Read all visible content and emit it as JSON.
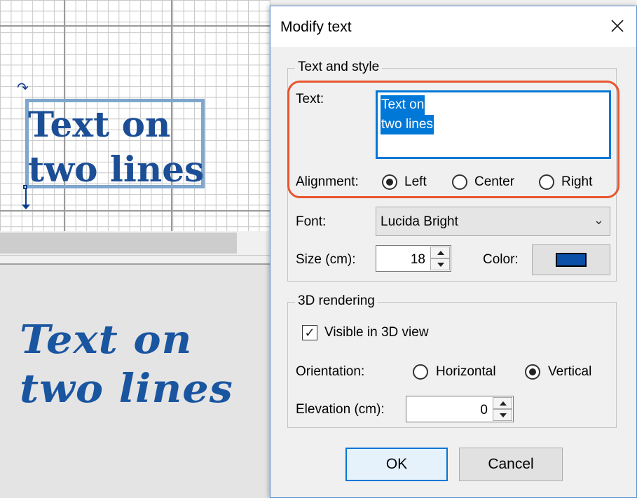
{
  "background": {
    "plan_text_lines": "Text on\ntwo lines",
    "view3d_text_lines": "Text on\ntwo lines",
    "text_color": "#1c4e96"
  },
  "dialog": {
    "title": "Modify text",
    "close_icon": "close-icon",
    "text_and_style": {
      "group_label": "Text and style",
      "text_label": "Text:",
      "text_value_lines": [
        "Text on",
        "two lines"
      ],
      "alignment_label": "Alignment:",
      "alignment_options": [
        {
          "label": "Left",
          "selected": true
        },
        {
          "label": "Center",
          "selected": false
        },
        {
          "label": "Right",
          "selected": false
        }
      ],
      "font_label": "Font:",
      "font_value": "Lucida Bright",
      "size_label": "Size (cm):",
      "size_value": "18",
      "color_label": "Color:",
      "color_value": "#0a4fa8"
    },
    "rendering_3d": {
      "group_label": "3D rendering",
      "visible_label": "Visible in 3D view",
      "visible_checked": true,
      "orientation_label": "Orientation:",
      "orientation_options": [
        {
          "label": "Horizontal",
          "selected": false
        },
        {
          "label": "Vertical",
          "selected": true
        }
      ],
      "elevation_label": "Elevation (cm):",
      "elevation_value": "0"
    },
    "ok_label": "OK",
    "cancel_label": "Cancel",
    "highlight_color": "#e8552f",
    "accent_color": "#0078d7"
  }
}
